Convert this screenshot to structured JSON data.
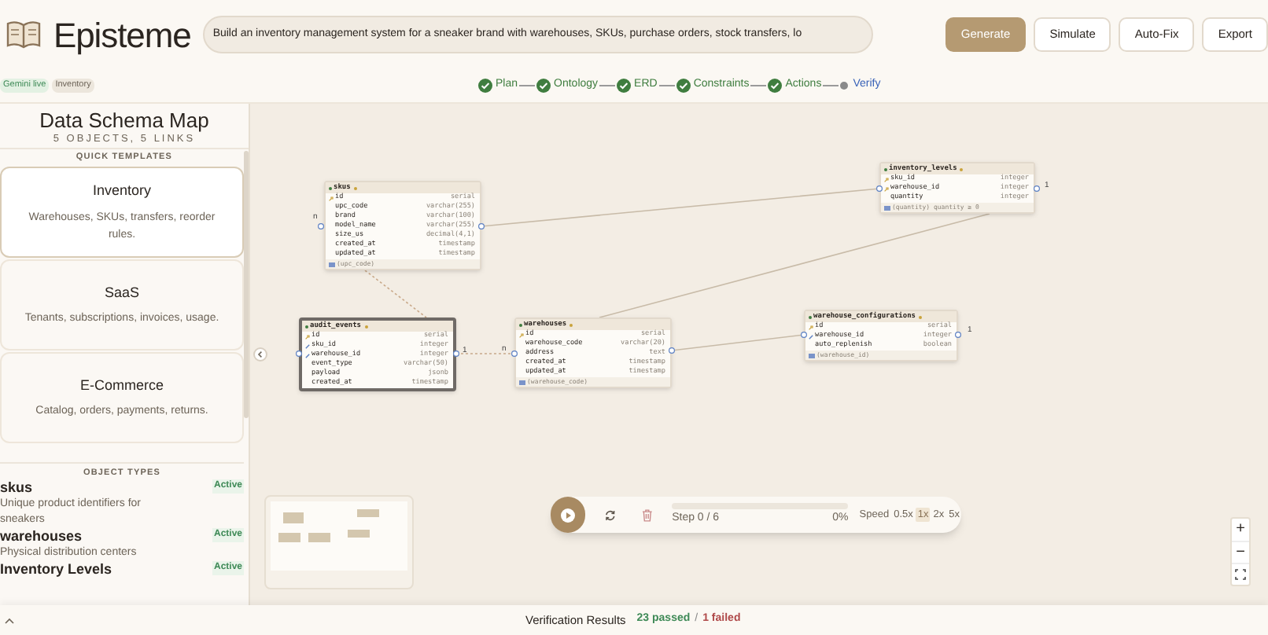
{
  "app": {
    "name": "Episteme"
  },
  "prompt": {
    "value": "Build an inventory management system for a sneaker brand with warehouses, SKUs, purchase orders, stock transfers, lo"
  },
  "header_buttons": [
    {
      "label": "Generate",
      "kind": "primary"
    },
    {
      "label": "Simulate",
      "kind": "secondary"
    },
    {
      "label": "Auto-Fix",
      "kind": "secondary"
    },
    {
      "label": "Export",
      "kind": "secondary"
    }
  ],
  "badges": [
    {
      "label": "Gemini live",
      "kind": "live"
    },
    {
      "label": "Inventory",
      "kind": "tag"
    }
  ],
  "pipeline": [
    {
      "label": "Plan",
      "completed": true
    },
    {
      "label": "Ontology",
      "completed": true
    },
    {
      "label": "ERD",
      "completed": true
    },
    {
      "label": "Constraints",
      "completed": true
    },
    {
      "label": "Actions",
      "completed": true
    },
    {
      "label": "Verify",
      "completed": false
    }
  ],
  "sidebar": {
    "title": "Data Schema Map",
    "subtitle": "5 OBJECTS, 5 LINKS",
    "templates_heading": "QUICK TEMPLATES",
    "templates": [
      {
        "title": "Inventory",
        "description": "Warehouses, SKUs, transfers, reorder rules.",
        "selected": true
      },
      {
        "title": "SaaS",
        "description": "Tenants, subscriptions, invoices, usage.",
        "selected": false
      },
      {
        "title": "E-Commerce",
        "description": "Catalog, orders, payments, returns.",
        "selected": false
      }
    ],
    "object_types_heading": "OBJECT TYPES",
    "object_types": [
      {
        "name": "skus",
        "status": "Active",
        "description": "Unique product identifiers for sneakers"
      },
      {
        "name": "warehouses",
        "status": "Active",
        "description": "Physical distribution centers"
      },
      {
        "name": "Inventory Levels",
        "status": "Active"
      }
    ]
  },
  "tables": [
    {
      "name": "skus",
      "selected": false,
      "fields": [
        {
          "name": "id",
          "type": "serial",
          "kind": "pk"
        },
        {
          "name": "upc_code",
          "type": "varchar(255)",
          "kind": "plain"
        },
        {
          "name": "brand",
          "type": "varchar(100)",
          "kind": "plain"
        },
        {
          "name": "model_name",
          "type": "varchar(255)",
          "kind": "plain"
        },
        {
          "name": "size_us",
          "type": "decimal(4,1)",
          "kind": "plain"
        },
        {
          "name": "created_at",
          "type": "timestamp",
          "kind": "plain"
        },
        {
          "name": "updated_at",
          "type": "timestamp",
          "kind": "plain"
        }
      ],
      "footer": "(upc_code)"
    },
    {
      "name": "audit_events",
      "selected": true,
      "fields": [
        {
          "name": "id",
          "type": "serial",
          "kind": "pk"
        },
        {
          "name": "sku_id",
          "type": "integer",
          "kind": "fk"
        },
        {
          "name": "warehouse_id",
          "type": "integer",
          "kind": "fk"
        },
        {
          "name": "event_type",
          "type": "varchar(50)",
          "kind": "plain"
        },
        {
          "name": "payload",
          "type": "jsonb",
          "kind": "plain"
        },
        {
          "name": "created_at",
          "type": "timestamp",
          "kind": "plain"
        }
      ]
    },
    {
      "name": "warehouses",
      "selected": false,
      "fields": [
        {
          "name": "id",
          "type": "serial",
          "kind": "pk"
        },
        {
          "name": "warehouse_code",
          "type": "varchar(20)",
          "kind": "plain"
        },
        {
          "name": "address",
          "type": "text",
          "kind": "plain"
        },
        {
          "name": "created_at",
          "type": "timestamp",
          "kind": "plain"
        },
        {
          "name": "updated_at",
          "type": "timestamp",
          "kind": "plain"
        }
      ],
      "footer": "(warehouse_code)"
    },
    {
      "name": "warehouse_configurations",
      "selected": false,
      "fields": [
        {
          "name": "id",
          "type": "serial",
          "kind": "pk"
        },
        {
          "name": "warehouse_id",
          "type": "integer",
          "kind": "fk"
        },
        {
          "name": "auto_replenish",
          "type": "boolean",
          "kind": "plain"
        }
      ],
      "footer": "(warehouse_id)"
    },
    {
      "name": "inventory_levels",
      "selected": false,
      "fields": [
        {
          "name": "sku_id",
          "type": "integer",
          "kind": "pk"
        },
        {
          "name": "warehouse_id",
          "type": "integer",
          "kind": "pk"
        },
        {
          "name": "quantity",
          "type": "integer",
          "kind": "plain"
        }
      ],
      "footer": "(quantity) quantity ≥ 0"
    }
  ],
  "links": [
    {
      "kind": "solid",
      "labels": [
        "1"
      ]
    },
    {
      "kind": "dashed",
      "labels": [
        "n"
      ]
    },
    {
      "kind": "dashed",
      "labels": [
        "1",
        "n"
      ]
    },
    {
      "kind": "solid",
      "labels": [
        "1"
      ]
    },
    {
      "kind": "solid"
    }
  ],
  "simulation": {
    "step": "Step 0 / 6",
    "percent": "0%",
    "level": 0,
    "speed_label": "Speed",
    "speeds": [
      {
        "label": "0.5x",
        "selected": false
      },
      {
        "label": "1x",
        "selected": true
      },
      {
        "label": "2x",
        "selected": false
      },
      {
        "label": "5x",
        "selected": false
      }
    ]
  },
  "zoom_controls": [
    "+",
    "−"
  ],
  "verification": {
    "title": "Verification Results",
    "passed": "23 passed",
    "separator": "/",
    "failed": "1 failed"
  }
}
